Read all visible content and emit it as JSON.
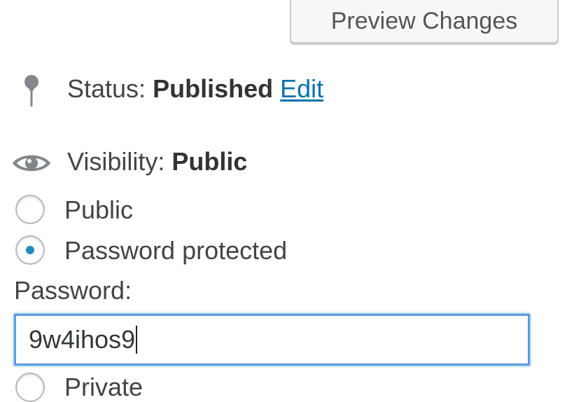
{
  "preview_button": {
    "label": "Preview Changes"
  },
  "status": {
    "label": "Status:",
    "value": "Published",
    "edit_link": "Edit",
    "icon": "pin-icon"
  },
  "visibility": {
    "label": "Visibility:",
    "value": "Public",
    "icon": "eye-icon",
    "options": [
      {
        "label": "Public",
        "checked": false
      },
      {
        "label": "Password protected",
        "checked": true
      },
      {
        "label": "Private",
        "checked": false
      }
    ],
    "password_label": "Password:",
    "password_value": "9w4ihos9"
  },
  "colors": {
    "link": "#0073aa",
    "radio_dot": "#1e8cbe",
    "focus_border": "#5b9dd9"
  }
}
